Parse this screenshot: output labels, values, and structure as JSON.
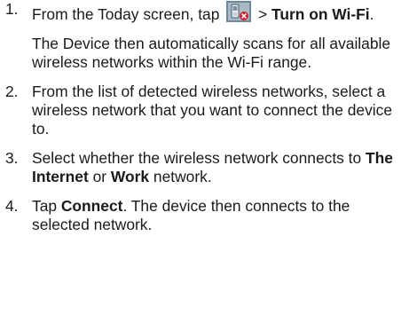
{
  "steps": [
    {
      "number": "1.",
      "text_before_icon": "From the Today screen, tap ",
      "icon": "wireless-connection-icon",
      "text_after_icon": " > ",
      "bold_action": "Turn on Wi-Fi",
      "text_end": ".",
      "sub_text": "The Device then automatically scans for all available wireless networks within the Wi-Fi range."
    },
    {
      "number": "2.",
      "text": "From the list of detected wireless networks, select a wireless network that you want to connect the device to."
    },
    {
      "number": "3.",
      "text_a": "Select whether the wireless network connects to ",
      "bold_a": "The Internet",
      "text_b": " or ",
      "bold_b": "Work",
      "text_c": " network."
    },
    {
      "number": "4.",
      "text_a": "Tap ",
      "bold_a": "Connect",
      "text_b": ". The device then connects to the selected network."
    }
  ],
  "colors": {
    "text": "#1a1a1a",
    "icon_device": "#8a9aa8",
    "icon_badge": "#d0202a"
  }
}
